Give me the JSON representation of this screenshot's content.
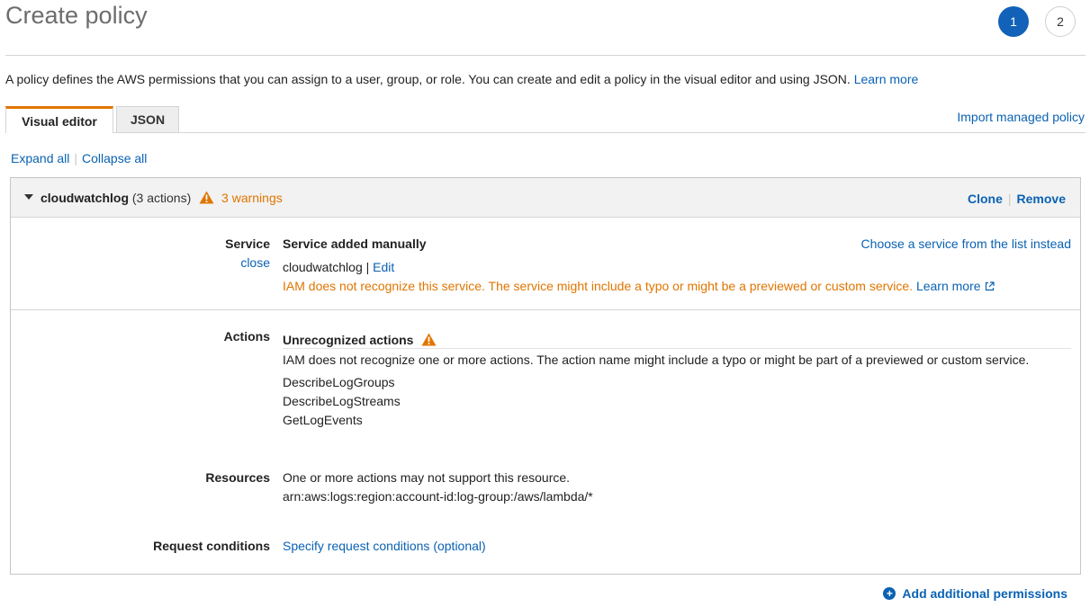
{
  "header": {
    "title": "Create policy",
    "steps": [
      "1",
      "2"
    ]
  },
  "intro": {
    "text": "A policy defines the AWS permissions that you can assign to a user, group, or role. You can create and edit a policy in the visual editor and using JSON. ",
    "learn_more": "Learn more"
  },
  "tabs": {
    "visual_editor": "Visual editor",
    "json": "JSON",
    "import_managed": "Import managed policy"
  },
  "toolbar": {
    "expand_all": "Expand all",
    "collapse_all": "Collapse all"
  },
  "statement": {
    "service_name": "cloudwatchlog",
    "actions_count": "(3 actions)",
    "warnings": "3 warnings",
    "clone": "Clone",
    "remove": "Remove",
    "service": {
      "label": "Service",
      "close": "close",
      "title": "Service added manually",
      "choose": "Choose a service from the list instead",
      "value": "cloudwatchlog",
      "separator": "|",
      "edit": "Edit",
      "warning": "IAM does not recognize this service. The service might include a typo or might be a previewed or custom service.",
      "learn_more": "Learn more"
    },
    "actions": {
      "label": "Actions",
      "title": "Unrecognized actions",
      "warning": "IAM does not recognize one or more actions. The action name might include a typo or might be part of a previewed or custom service.",
      "items": [
        "DescribeLogGroups",
        "DescribeLogStreams",
        "GetLogEvents"
      ]
    },
    "resources": {
      "label": "Resources",
      "warning": "One or more actions may not support this resource.",
      "arn": "arn:aws:logs:region:account-id:log-group:/aws/lambda/*"
    },
    "conditions": {
      "label": "Request conditions",
      "link": "Specify request conditions (optional)"
    }
  },
  "footer": {
    "add_permissions": "Add additional permissions"
  },
  "colors": {
    "link": "#0a62b3",
    "warning": "#e07500",
    "active_step": "#1162b8"
  }
}
